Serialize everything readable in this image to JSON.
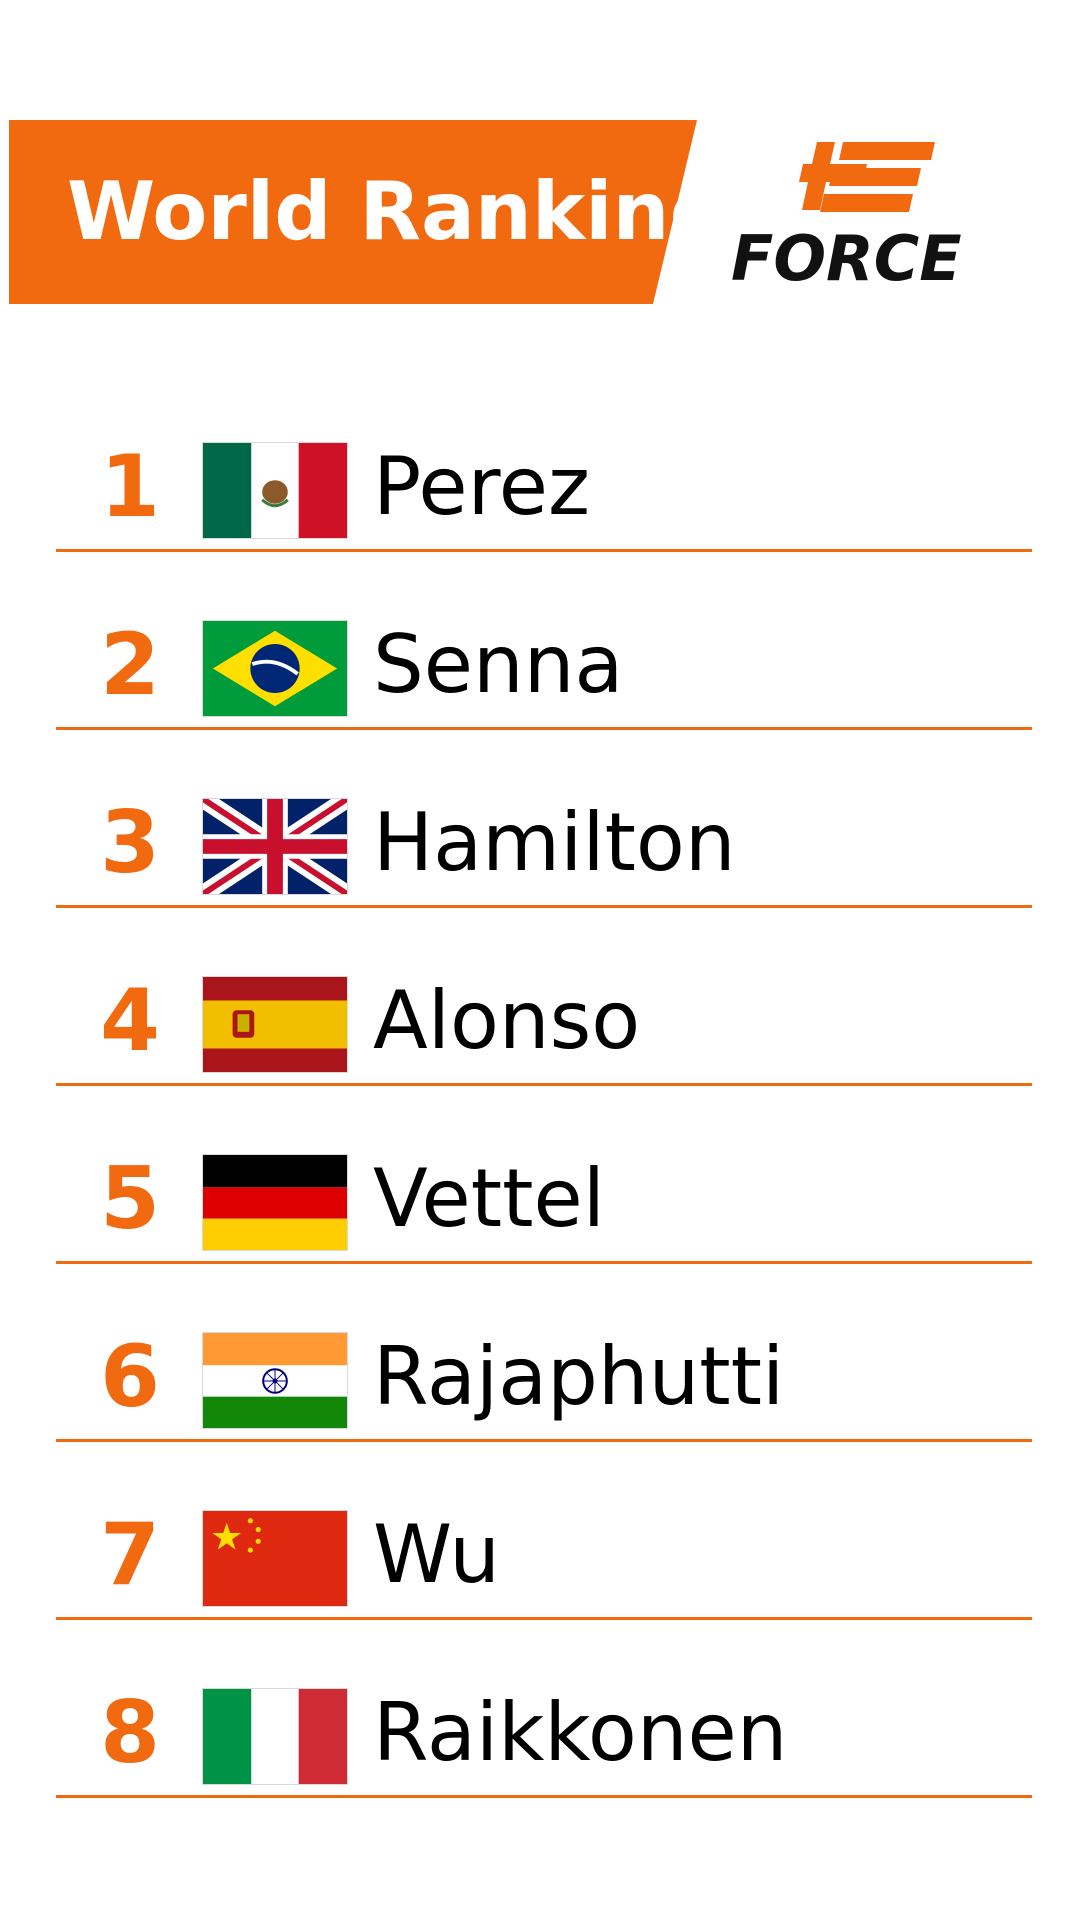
{
  "header": {
    "title": "World Ranking",
    "brand": "FORCE",
    "accent_color": "#F26A10"
  },
  "rankings": [
    {
      "rank": "1",
      "name": "Perez",
      "flag": "mexico-flag-icon"
    },
    {
      "rank": "2",
      "name": "Senna",
      "flag": "brazil-flag-icon"
    },
    {
      "rank": "3",
      "name": "Hamilton",
      "flag": "uk-flag-icon"
    },
    {
      "rank": "4",
      "name": "Alonso",
      "flag": "spain-flag-icon"
    },
    {
      "rank": "5",
      "name": "Vettel",
      "flag": "germany-flag-icon"
    },
    {
      "rank": "6",
      "name": "Rajaphutti",
      "flag": "india-flag-icon"
    },
    {
      "rank": "7",
      "name": "Wu",
      "flag": "china-flag-icon"
    },
    {
      "rank": "8",
      "name": "Raikkonen",
      "flag": "italy-flag-icon"
    }
  ]
}
